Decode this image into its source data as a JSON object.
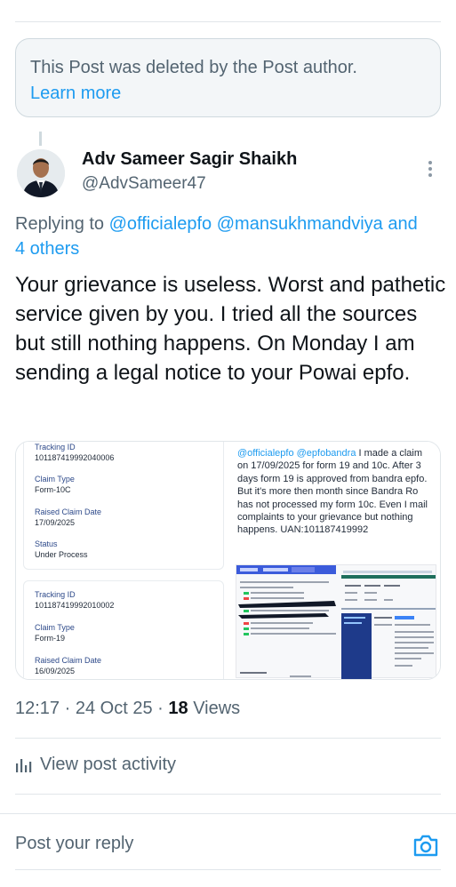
{
  "deleted_notice": {
    "text": "This Post was deleted by the Post author.",
    "link": "Learn more"
  },
  "author": {
    "name": "Adv Sameer Sagir Shaikh",
    "handle": "@AdvSameer47"
  },
  "replying": {
    "prefix": "Replying to",
    "mention1": "@officialepfo",
    "mention2": "@mansukhmandviya",
    "suffix": "and",
    "others": "4 others"
  },
  "post": {
    "text": "Your grievance is useless. Worst and pathetic service given by you. I tried all the sources but still  nothing happens. On Monday I am sending a legal notice to your Powai epfo."
  },
  "media": {
    "card1": {
      "tracking_label": "Tracking ID",
      "tracking_value": "101187419992040006",
      "claim_type_label": "Claim Type",
      "claim_type_value": "Form-10C",
      "raised_label": "Raised Claim Date",
      "raised_value": "17/09/2025",
      "status_label": "Status",
      "status_value": "Under Process"
    },
    "card2": {
      "tracking_label": "Tracking ID",
      "tracking_value": "101187419992010002",
      "claim_type_label": "Claim Type",
      "claim_type_value": "Form-19",
      "raised_label": "Raised Claim Date",
      "raised_value": "16/09/2025"
    },
    "tweet_mentions": "@officialepfo @epfobandra",
    "tweet_text": " I made a claim on 17/09/2025 for form 19 and 10c. After 3 days form 19 is approved from bandra epfo. But it's more then month since Bandra Ro has not processed my  form 10c. Even I mail complaints to your grievance but nothing happens. UAN:101187419992"
  },
  "meta": {
    "time": "12:17",
    "date": "24 Oct 25",
    "views_count": "18",
    "views_label": "Views"
  },
  "activity": {
    "label": "View post activity"
  },
  "reply": {
    "placeholder": "Post your reply"
  },
  "colors": {
    "accent": "#1d9bf0",
    "muted": "#536471",
    "text": "#0f1419"
  },
  "icons": [
    "more-vertical-icon",
    "bar-chart-icon",
    "camera-icon"
  ]
}
